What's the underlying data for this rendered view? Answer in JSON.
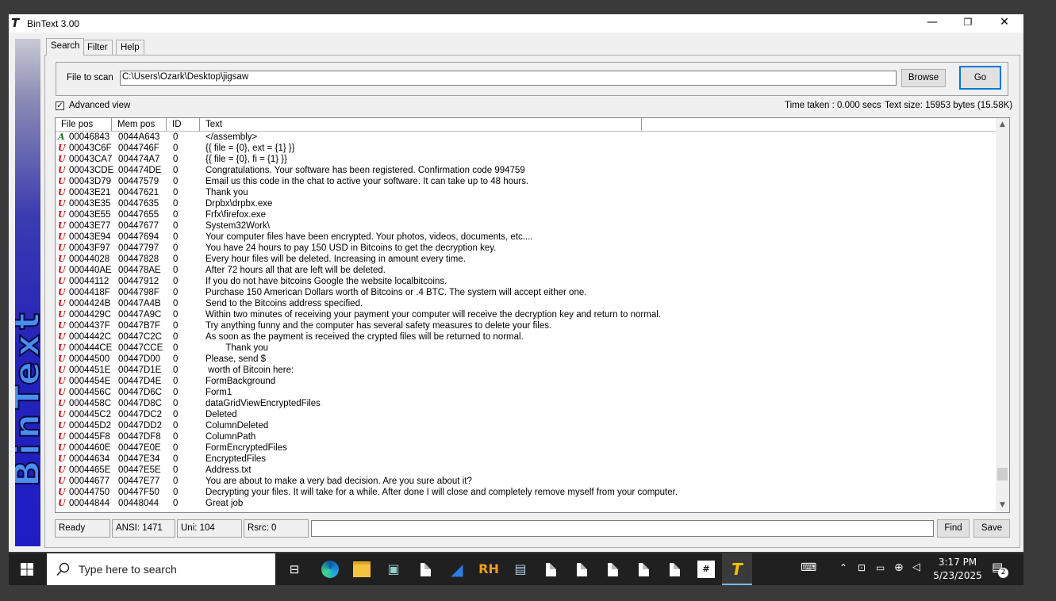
{
  "window": {
    "title": "BinText 3.00",
    "controls": {
      "minimize": "—",
      "restore": "❐",
      "close": "✕"
    }
  },
  "sidebar": {
    "brand": "BinText"
  },
  "tabs": [
    {
      "label": "Search"
    },
    {
      "label": "Filter"
    },
    {
      "label": "Help"
    }
  ],
  "file_section": {
    "label": "File to scan",
    "path": "C:\\Users\\Ozark\\Desktop\\jigsaw",
    "browse_label": "Browse",
    "go_label": "Go"
  },
  "options": {
    "advanced_view_label": "Advanced view",
    "advanced_view_checked": true,
    "time_taken": "Time taken : 0.000 secs",
    "text_size": "Text size: 15953 bytes (15.58K)"
  },
  "table": {
    "columns": [
      "File pos",
      "Mem pos",
      "ID",
      "Text"
    ],
    "rows": [
      {
        "type": "A",
        "file": "00046843",
        "mem": "0044A643",
        "id": "0",
        "text": "</assembly>"
      },
      {
        "type": "U",
        "file": "00043C6F",
        "mem": "0044746F",
        "id": "0",
        "text": "{{ file = {0}, ext = {1} }}"
      },
      {
        "type": "U",
        "file": "00043CA7",
        "mem": "004474A7",
        "id": "0",
        "text": "{{ file = {0}, fi = {1} }}"
      },
      {
        "type": "U",
        "file": "00043CDE",
        "mem": "004474DE",
        "id": "0",
        "text": "Congratulations. Your software has been registered. Confirmation code 994759"
      },
      {
        "type": "U",
        "file": "00043D79",
        "mem": "00447579",
        "id": "0",
        "text": "Email us this code in the chat to active your software. It can take up to 48 hours."
      },
      {
        "type": "U",
        "file": "00043E21",
        "mem": "00447621",
        "id": "0",
        "text": "Thank you"
      },
      {
        "type": "U",
        "file": "00043E35",
        "mem": "00447635",
        "id": "0",
        "text": "Drpbx\\drpbx.exe"
      },
      {
        "type": "U",
        "file": "00043E55",
        "mem": "00447655",
        "id": "0",
        "text": "Frfx\\firefox.exe"
      },
      {
        "type": "U",
        "file": "00043E77",
        "mem": "00447677",
        "id": "0",
        "text": "System32Work\\"
      },
      {
        "type": "U",
        "file": "00043E94",
        "mem": "00447694",
        "id": "0",
        "text": "Your computer files have been encrypted. Your photos, videos, documents, etc...."
      },
      {
        "type": "U",
        "file": "00043F97",
        "mem": "00447797",
        "id": "0",
        "text": "You have 24 hours to pay 150 USD in Bitcoins to get the decryption key."
      },
      {
        "type": "U",
        "file": "00044028",
        "mem": "00447828",
        "id": "0",
        "text": "Every hour files will be deleted. Increasing in amount every time."
      },
      {
        "type": "U",
        "file": "000440AE",
        "mem": "004478AE",
        "id": "0",
        "text": "After 72 hours all that are left will be deleted."
      },
      {
        "type": "U",
        "file": "00044112",
        "mem": "00447912",
        "id": "0",
        "text": "If you do not have bitcoins Google the website localbitcoins."
      },
      {
        "type": "U",
        "file": "0004418F",
        "mem": "0044798F",
        "id": "0",
        "text": "Purchase 150 American Dollars worth of Bitcoins or .4 BTC. The system will accept either one."
      },
      {
        "type": "U",
        "file": "0004424B",
        "mem": "00447A4B",
        "id": "0",
        "text": "Send to the Bitcoins address specified."
      },
      {
        "type": "U",
        "file": "0004429C",
        "mem": "00447A9C",
        "id": "0",
        "text": "Within two minutes of receiving your payment your computer will receive the decryption key and return to normal."
      },
      {
        "type": "U",
        "file": "0004437F",
        "mem": "00447B7F",
        "id": "0",
        "text": "Try anything funny and the computer has several safety measures to delete your files."
      },
      {
        "type": "U",
        "file": "0004442C",
        "mem": "00447C2C",
        "id": "0",
        "text": "As soon as the payment is received the crypted files will be returned to normal."
      },
      {
        "type": "U",
        "file": "000444CE",
        "mem": "00447CCE",
        "id": "0",
        "text": "        Thank you"
      },
      {
        "type": "U",
        "file": "00044500",
        "mem": "00447D00",
        "id": "0",
        "text": "Please, send $"
      },
      {
        "type": "U",
        "file": "0004451E",
        "mem": "00447D1E",
        "id": "0",
        "text": " worth of Bitcoin here:"
      },
      {
        "type": "U",
        "file": "0004454E",
        "mem": "00447D4E",
        "id": "0",
        "text": "FormBackground"
      },
      {
        "type": "U",
        "file": "0004456C",
        "mem": "00447D6C",
        "id": "0",
        "text": "Form1"
      },
      {
        "type": "U",
        "file": "0004458C",
        "mem": "00447D8C",
        "id": "0",
        "text": "dataGridViewEncryptedFiles"
      },
      {
        "type": "U",
        "file": "000445C2",
        "mem": "00447DC2",
        "id": "0",
        "text": "Deleted"
      },
      {
        "type": "U",
        "file": "000445D2",
        "mem": "00447DD2",
        "id": "0",
        "text": "ColumnDeleted"
      },
      {
        "type": "U",
        "file": "000445F8",
        "mem": "00447DF8",
        "id": "0",
        "text": "ColumnPath"
      },
      {
        "type": "U",
        "file": "0004460E",
        "mem": "00447E0E",
        "id": "0",
        "text": "FormEncryptedFiles"
      },
      {
        "type": "U",
        "file": "00044634",
        "mem": "00447E34",
        "id": "0",
        "text": "EncryptedFiles"
      },
      {
        "type": "U",
        "file": "0004465E",
        "mem": "00447E5E",
        "id": "0",
        "text": "Address.txt"
      },
      {
        "type": "U",
        "file": "00044677",
        "mem": "00447E77",
        "id": "0",
        "text": "You are about to make a very bad decision. Are you sure about it?"
      },
      {
        "type": "U",
        "file": "00044750",
        "mem": "00447F50",
        "id": "0",
        "text": "Decrypting your files. It will take for a while. After done I will close and completely remove myself from your computer."
      },
      {
        "type": "U",
        "file": "00044844",
        "mem": "00448044",
        "id": "0",
        "text": "Great job"
      }
    ]
  },
  "statusbar": {
    "ready": "Ready",
    "ansi": "ANSI: 1471",
    "uni": "Uni: 104",
    "rsrc": "Rsrc: 0",
    "find_value": "",
    "find_label": "Find",
    "save_label": "Save"
  },
  "taskbar": {
    "search_placeholder": "Type here to search",
    "time": "3:17 PM",
    "date": "5/23/2025",
    "notification_count": "2",
    "pinned_text_icons": {
      "rh": "RH",
      "hash": "#",
      "bintext": "T"
    }
  },
  "colors": {
    "ascii_type": "#1a7a1a",
    "unicode_type": "#cc1010",
    "default_button_border": "#0078d7",
    "taskbar_bg": "#202020"
  }
}
